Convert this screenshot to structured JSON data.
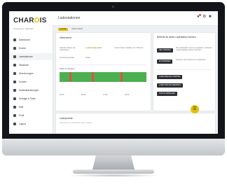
{
  "brand": {
    "logo_text_pre": "CHAR",
    "logo_text_o": "O",
    "logo_text_post": "IS",
    "powered_by": "Powered by ORATEC"
  },
  "sidebar": {
    "items": [
      {
        "label": "Dashboard"
      },
      {
        "label": "Events"
      },
      {
        "label": "Ladestationen"
      },
      {
        "label": "Standorte"
      },
      {
        "label": "Abrechnungen"
      },
      {
        "label": "Kunden"
      },
      {
        "label": "Kartenaktivierungen"
      },
      {
        "label": "Verträge & Tarife"
      },
      {
        "label": "Hilfe"
      },
      {
        "label": "Profil"
      },
      {
        "label": "Logout"
      }
    ]
  },
  "header": {
    "title": "Ladestationen"
  },
  "status_tabs": [
    {
      "label": "ONLINE"
    },
    {
      "label": "VERFÜGBAR"
    }
  ],
  "overview": {
    "title": "Übersicht",
    "rows": [
      {
        "label": "Aktueller Status der Ladestation",
        "value": "● Ladevorgang läuft",
        "note": "Letzter Status-Update vor 2 Minuten"
      },
      {
        "label": "Verbindungsstatus",
        "value": "Online",
        "note": ""
      }
    ],
    "timeline_label": "Status im Zeitraum",
    "timeline_ticks": [
      "00:00",
      "06:00",
      "12:00",
      "18:00"
    ]
  },
  "actions": {
    "title": "Befehle an diese Ladestation senden",
    "items": [
      {
        "button": "NEU STARTEN",
        "description": "Die Ladestation wird neu gestartet. Laufende Ladevorgänge werden beendet."
      },
      {
        "button": "ENTSPERREN",
        "description": "Entsperrt den Stecker am Ladepunkt."
      }
    ],
    "extra_buttons": [
      "LADEVORGANG STARTEN",
      "LADEVORGANG BEENDEN",
      "STATUS ABFRAGEN"
    ]
  },
  "bottom_card": {
    "title": "Ladepunkte",
    "subtitle": "Übersicht der Ladepunkte dieser Station"
  },
  "colors": {
    "accent": "#e6c200",
    "timeline_green": "#4caf50",
    "timeline_red": "#e0533d",
    "dark": "#2d2f33"
  },
  "icons": {
    "notifications": "bell-icon",
    "settings": "gear-icon",
    "user": "user-icon",
    "fab": "menu-icon"
  }
}
